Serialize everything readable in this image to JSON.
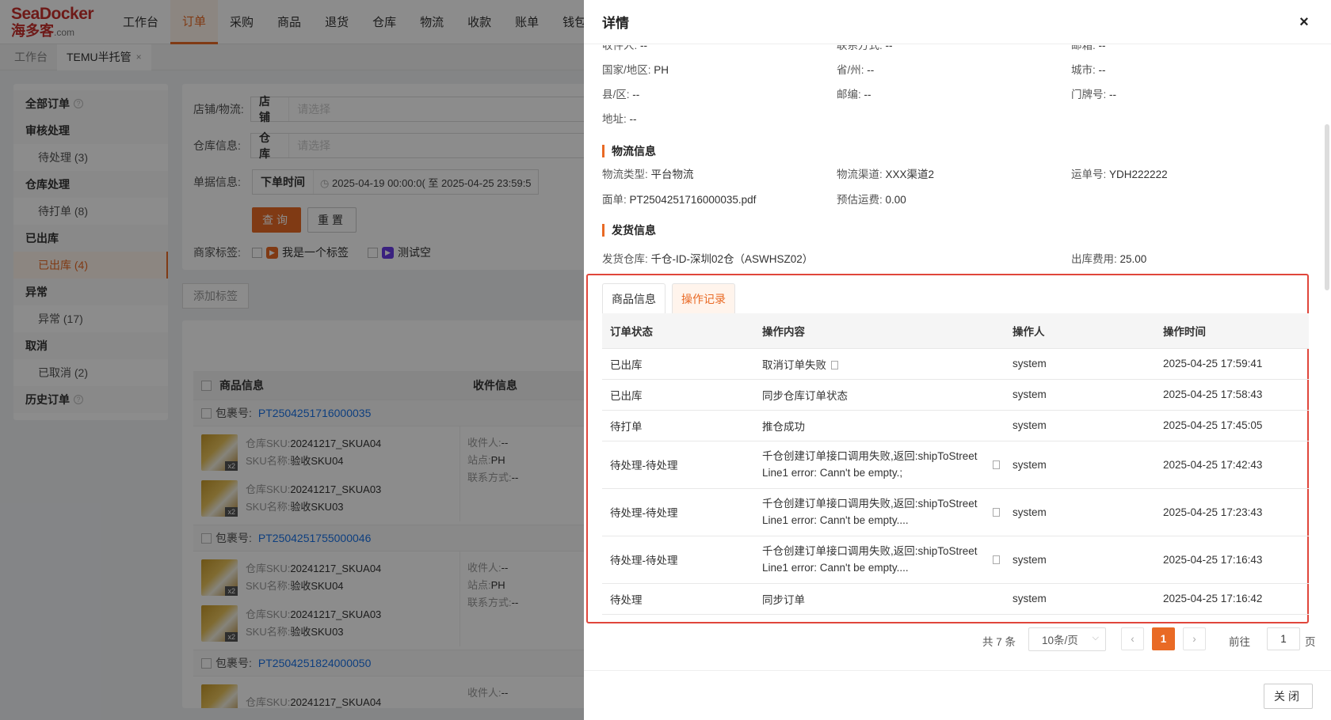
{
  "app": {
    "logo_en": "SeaDocker",
    "logo_cn": "海多客",
    "logo_suffix": ".com",
    "nav": [
      "工作台",
      "订单",
      "采购",
      "商品",
      "退货",
      "仓库",
      "物流",
      "收款",
      "账单",
      "钱包"
    ],
    "nav_active": "订单",
    "tabs": [
      {
        "label": "工作台"
      },
      {
        "label": "TEMU半托管",
        "close": "×"
      }
    ]
  },
  "sidebar": {
    "all_orders": "全部订单",
    "review": "审核处理",
    "pending": "待处理 (3)",
    "warehouse": "仓库处理",
    "to_print": "待打单 (8)",
    "shipped_group": "已出库",
    "shipped": "已出库 (4)",
    "exception_group": "异常",
    "exception": "异常 (17)",
    "cancel_group": "取消",
    "cancelled": "已取消 (2)",
    "history": "历史订单",
    "help": "?"
  },
  "filters": {
    "store_label": "店铺/物流:",
    "store_type": "店铺",
    "store_placeholder": "请选择",
    "wh_label": "仓库信息:",
    "wh_type": "仓库",
    "wh_placeholder": "请选择",
    "doc_label": "单据信息:",
    "doc_type": "下单时间",
    "date_start": "2025-04-19 00:00:0(",
    "date_sep": "至",
    "date_end": "2025-04-25 23:59:5",
    "query": "查询",
    "reset": "重置",
    "tag_label": "商家标签:",
    "tag1": "我是一个标签",
    "tag2": "测试空",
    "add_tag": "添加标签"
  },
  "orders": {
    "col_product": "商品信息",
    "col_receiver": "收件信息",
    "pkg_label": "包裹号:",
    "packages": [
      "PT2504251716000035",
      "PT2504251755000046",
      "PT2504251824000050"
    ],
    "sku_label": "仓库SKU:",
    "name_label": "SKU名称:",
    "sku1": "20241217_SKUA04",
    "name1": "验收SKU04",
    "sku2": "20241217_SKUA03",
    "name2": "验收SKU03",
    "sku_partial": "20241217_SKUA04",
    "qty": "x2",
    "recv_label": "收件人:",
    "recv_val": "--",
    "site_label": "站点:",
    "site_val": "PH",
    "contact_label": "联系方式:",
    "contact_val": "--"
  },
  "drawer": {
    "title": "详情",
    "close_icon": "×",
    "addr": {
      "cut1_label": "收件人:",
      "cut1_val": "--",
      "cut2_label": "联系方式:",
      "cut2_val": "--",
      "cut3_label": "邮箱:",
      "cut3_val": "--",
      "country_label": "国家/地区:",
      "country_val": "PH",
      "province_label": "省/州:",
      "province_val": "--",
      "city_label": "城市:",
      "city_val": "--",
      "county_label": "县/区:",
      "county_val": "--",
      "zip_label": "邮编:",
      "zip_val": "--",
      "door_label": "门牌号:",
      "door_val": "--",
      "address_label": "地址:",
      "address_val": "--"
    },
    "logistics": {
      "title": "物流信息",
      "type_label": "物流类型:",
      "type_val": "平台物流",
      "channel_label": "物流渠道:",
      "channel_val": "XXX渠道2",
      "waybill_label": "运单号:",
      "waybill_val": "YDH222222",
      "label_label": "面单:",
      "label_val": "PT2504251716000035.pdf",
      "fee_label": "预估运费:",
      "fee_val": "0.00"
    },
    "shipping": {
      "title": "发货信息",
      "wh_label": "发货仓库:",
      "wh_val": "千仓-ID-深圳02仓（ASWHSZ02）",
      "out_fee_label": "出库费用:",
      "out_fee_val": "25.00"
    },
    "tabs": [
      "商品信息",
      "操作记录"
    ],
    "active_tab": "操作记录",
    "log_headers": [
      "订单状态",
      "操作内容",
      "操作人",
      "操作时间"
    ],
    "log_rows": [
      {
        "status": "已出库",
        "content": "取消订单失败",
        "operator": "system",
        "time": "2025-04-25 17:59:41"
      },
      {
        "status": "已出库",
        "content": "同步仓库订单状态",
        "operator": "system",
        "time": "2025-04-25 17:58:43"
      },
      {
        "status": "待打单",
        "content": "推仓成功",
        "operator": "system",
        "time": "2025-04-25 17:45:05"
      },
      {
        "status": "待处理-待处理",
        "content": "千仓创建订单接口调用失败,返回:shipToStreet",
        "content2": "Line1 error: Cann't be empty.;",
        "operator": "system",
        "time": "2025-04-25 17:42:43"
      },
      {
        "status": "待处理-待处理",
        "content": "千仓创建订单接口调用失败,返回:shipToStreet",
        "content2": "Line1 error: Cann't be empty....",
        "operator": "system",
        "time": "2025-04-25 17:23:43"
      },
      {
        "status": "待处理-待处理",
        "content": "千仓创建订单接口调用失败,返回:shipToStreet",
        "content2": "Line1 error: Cann't be empty....",
        "operator": "system",
        "time": "2025-04-25 17:16:43"
      },
      {
        "status": "待处理",
        "content": "同步订单",
        "operator": "system",
        "time": "2025-04-25 17:16:42"
      }
    ],
    "pager": {
      "total": "共 7 条",
      "page_size": "10条/页",
      "prev": "‹",
      "current": "1",
      "next": "›",
      "goto": "前往",
      "goto_val": "1",
      "page_unit": "页"
    },
    "close_button": "关闭"
  },
  "colors": {
    "accent": "#e96a25",
    "highlight_border": "#e0463b",
    "link": "#1a73e8"
  }
}
